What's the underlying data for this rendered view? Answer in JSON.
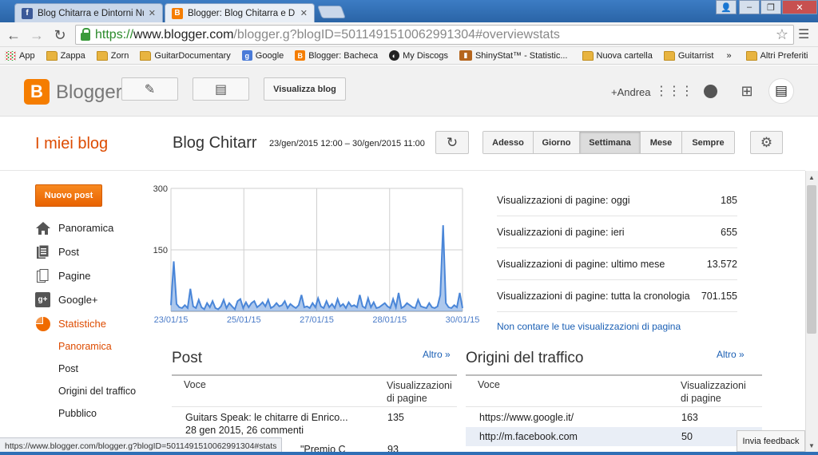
{
  "browser": {
    "tabs": [
      {
        "title": "Blog Chitarra e Dintorni Nuov",
        "icon": "facebook-icon",
        "color": "#3b5998",
        "active": false
      },
      {
        "title": "Blogger: Blog Chitarra e Dint",
        "icon": "blogger-icon",
        "color": "#f57d00",
        "active": true
      }
    ],
    "url": {
      "scheme": "https://",
      "host": "www.blogger.com",
      "path": "/blogger.g?blogID=5011491510062991304#overviewstats"
    },
    "bookmarks": [
      {
        "label": "App",
        "icon": "apps-icon"
      },
      {
        "label": "Zappa",
        "icon": "folder-icon"
      },
      {
        "label": "Zorn",
        "icon": "folder-icon"
      },
      {
        "label": "GuitarDocumentary",
        "icon": "folder-icon"
      },
      {
        "label": "Google",
        "icon": "google-icon"
      },
      {
        "label": "Blogger: Bacheca",
        "icon": "blogger-icon"
      },
      {
        "label": "My Discogs",
        "icon": "discogs-icon"
      },
      {
        "label": "ShinyStat™ - Statistic...",
        "icon": "shinystat-icon"
      },
      {
        "label": "Nuova cartella",
        "icon": "folder-icon"
      },
      {
        "label": "Guitarrist",
        "icon": "folder-icon"
      }
    ],
    "more_bookmarks": "»",
    "other_bookmarks": "Altri Preferiti",
    "status_url": "https://www.blogger.com/blogger.g?blogID=5011491510062991304#stats"
  },
  "header": {
    "brand": "Blogger",
    "view_blog": "Visualizza blog",
    "user": "+Andrea"
  },
  "subheader": {
    "my_blogs": "I miei blog",
    "blog_name": "Blog Chitarr",
    "range": "23/gen/2015 12:00 – 30/gen/2015 11:00",
    "periods": [
      {
        "label": "Adesso",
        "active": false
      },
      {
        "label": "Giorno",
        "active": false
      },
      {
        "label": "Settimana",
        "active": true
      },
      {
        "label": "Mese",
        "active": false
      },
      {
        "label": "Sempre",
        "active": false
      }
    ]
  },
  "sidebar": {
    "new_post": "Nuovo post",
    "items": [
      {
        "label": "Panoramica",
        "icon": "home-icon",
        "active": false
      },
      {
        "label": "Post",
        "icon": "posts-icon",
        "active": false
      },
      {
        "label": "Pagine",
        "icon": "pages-icon",
        "active": false
      },
      {
        "label": "Google+",
        "icon": "google-plus-icon",
        "active": false
      },
      {
        "label": "Statistiche",
        "icon": "stats-pie-icon",
        "active": true
      }
    ],
    "subitems": [
      {
        "label": "Panoramica",
        "active": true
      },
      {
        "label": "Post",
        "active": false
      },
      {
        "label": "Origini del traffico",
        "active": false
      },
      {
        "label": "Pubblico",
        "active": false
      }
    ]
  },
  "chart_data": {
    "type": "area",
    "x_ticks": [
      "23/01/15",
      "25/01/15",
      "27/01/15",
      "28/01/15",
      "30/01/15"
    ],
    "ylim": [
      0,
      300
    ],
    "y_ticks": [
      "300",
      "150"
    ],
    "grid": true,
    "color": "#4a86d8",
    "values": [
      15,
      122,
      18,
      10,
      8,
      15,
      8,
      55,
      12,
      8,
      28,
      10,
      5,
      20,
      10,
      25,
      8,
      5,
      12,
      28,
      8,
      20,
      12,
      5,
      25,
      30,
      8,
      22,
      10,
      20,
      25,
      10,
      15,
      22,
      12,
      28,
      8,
      12,
      20,
      12,
      15,
      25,
      8,
      18,
      12,
      8,
      15,
      40,
      10,
      12,
      8,
      20,
      10,
      32,
      12,
      8,
      25,
      10,
      18,
      8,
      30,
      12,
      18,
      8,
      22,
      12,
      15,
      10,
      40,
      12,
      8,
      32,
      10,
      22,
      8,
      10,
      15,
      20,
      12,
      8,
      30,
      10,
      45,
      8,
      12,
      20,
      15,
      10,
      8,
      28,
      12,
      10,
      8,
      20,
      10,
      8,
      12,
      40,
      210,
      20,
      10,
      8,
      15,
      10,
      45,
      8
    ]
  },
  "stats": {
    "rows": [
      {
        "label": "Visualizzazioni di pagine: oggi",
        "value": "185"
      },
      {
        "label": "Visualizzazioni di pagine: ieri",
        "value": "655"
      },
      {
        "label": "Visualizzazioni di pagine: ultimo mese",
        "value": "13.572"
      },
      {
        "label": "Visualizzazioni di pagine: tutta la cronologia",
        "value": "701.155"
      }
    ],
    "exclude_link": "Non contare le tue visualizzazioni di pagina"
  },
  "posts": {
    "title": "Post",
    "more": "Altro »",
    "col_item": "Voce",
    "col_views": "Visualizzazioni di pagine",
    "rows": [
      {
        "title": "Guitars Speak: le chitarre di Enrico...",
        "sub": "28 gen 2015, 26 commenti",
        "views": "135"
      },
      {
        "title": "\"Premio C",
        "sub": "",
        "views": "93"
      }
    ]
  },
  "traffic": {
    "title": "Origini del traffico",
    "more": "Altro »",
    "col_item": "Voce",
    "col_views": "Visualizzazioni di pagine",
    "rows": [
      {
        "source": "https://www.google.it/",
        "views": "163"
      },
      {
        "source": "http://m.facebook.com",
        "views": "50"
      }
    ]
  },
  "feedback": "Invia feedback"
}
